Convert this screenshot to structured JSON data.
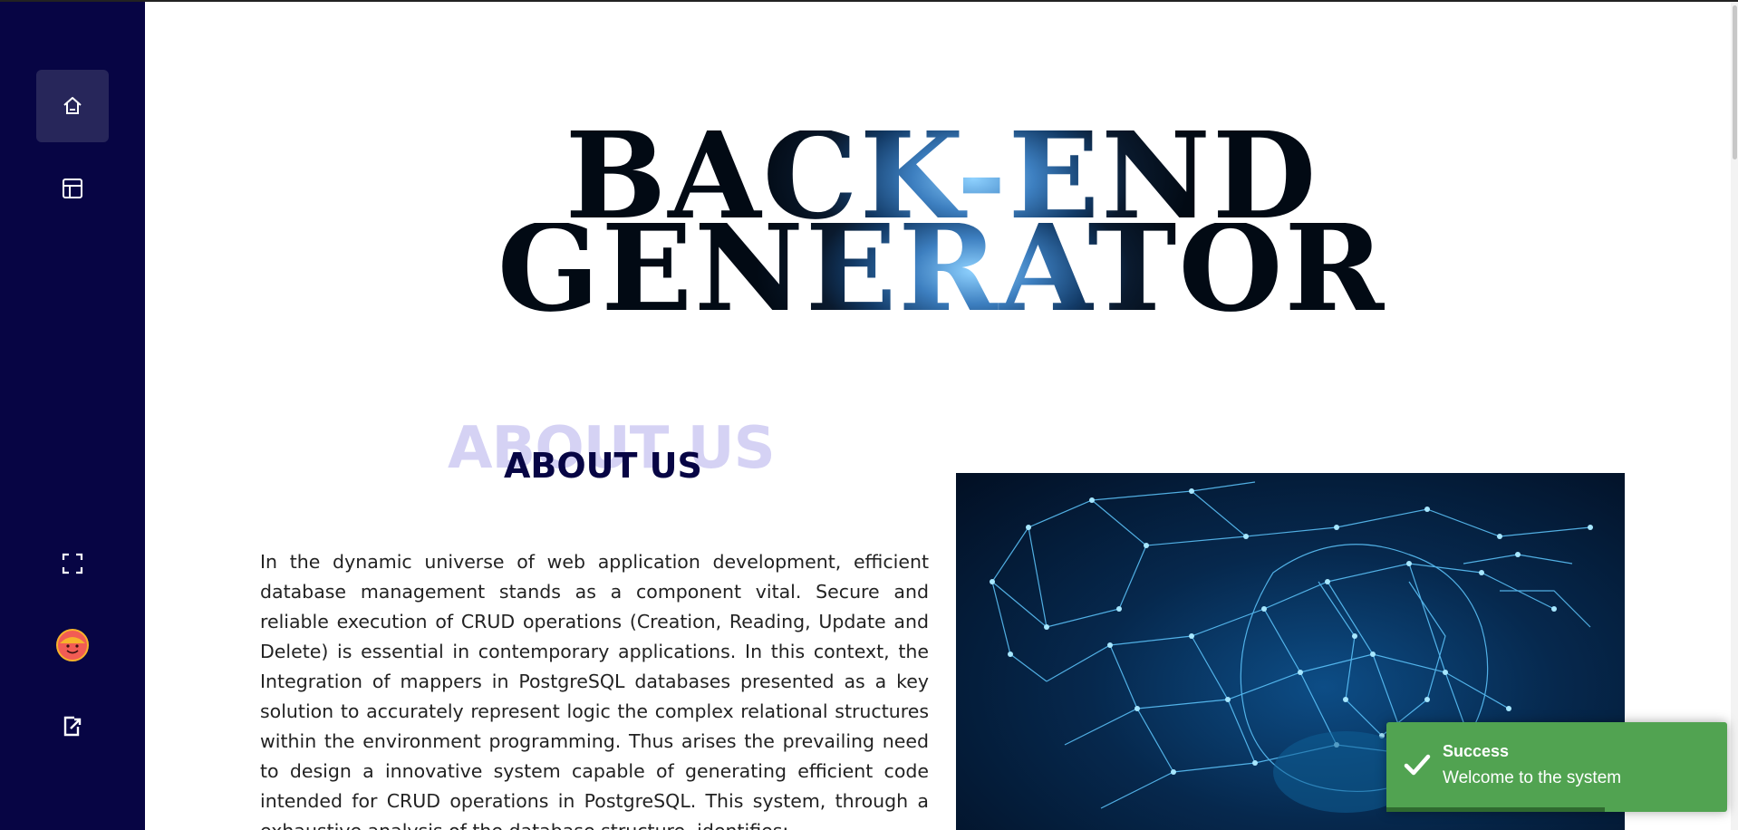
{
  "sidebar": {
    "items": [
      {
        "icon": "home-icon",
        "active": true
      },
      {
        "icon": "layout-icon",
        "active": false
      },
      {
        "icon": "fullscreen-icon",
        "active": false
      },
      {
        "icon": "avatar",
        "active": false
      },
      {
        "icon": "logout-icon",
        "active": false
      }
    ]
  },
  "hero": {
    "line1": "BACK-END",
    "line2": "GENERATOR"
  },
  "about": {
    "ghost_title": "ABOUT US",
    "title": "ABOUT US",
    "paragraph": "In the dynamic universe of web application development, efficient database management stands as a component vital. Secure and reliable execution of CRUD operations (Creation, Reading, Update and Delete) is essential in contemporary applications. In this context, the Integration of mappers in PostgreSQL databases presented as a key solution to accurately represent logic the complex relational structures within the environment programming. Thus arises the prevailing need to design a innovative system capable of generating efficient code intended for CRUD operations in PostgreSQL. This system, through a exhaustive analysis of the database structure, identifies:",
    "illustration": "handshake-network-illustration"
  },
  "toast": {
    "title": "Success",
    "message": "Welcome to the system",
    "progress": 0.64
  },
  "colors": {
    "sidebar_bg": "#070544",
    "sidebar_active": "#27265a",
    "accent_title": "#070544",
    "ghost_title": "#d5d2f4",
    "toast_bg": "#51a351"
  }
}
